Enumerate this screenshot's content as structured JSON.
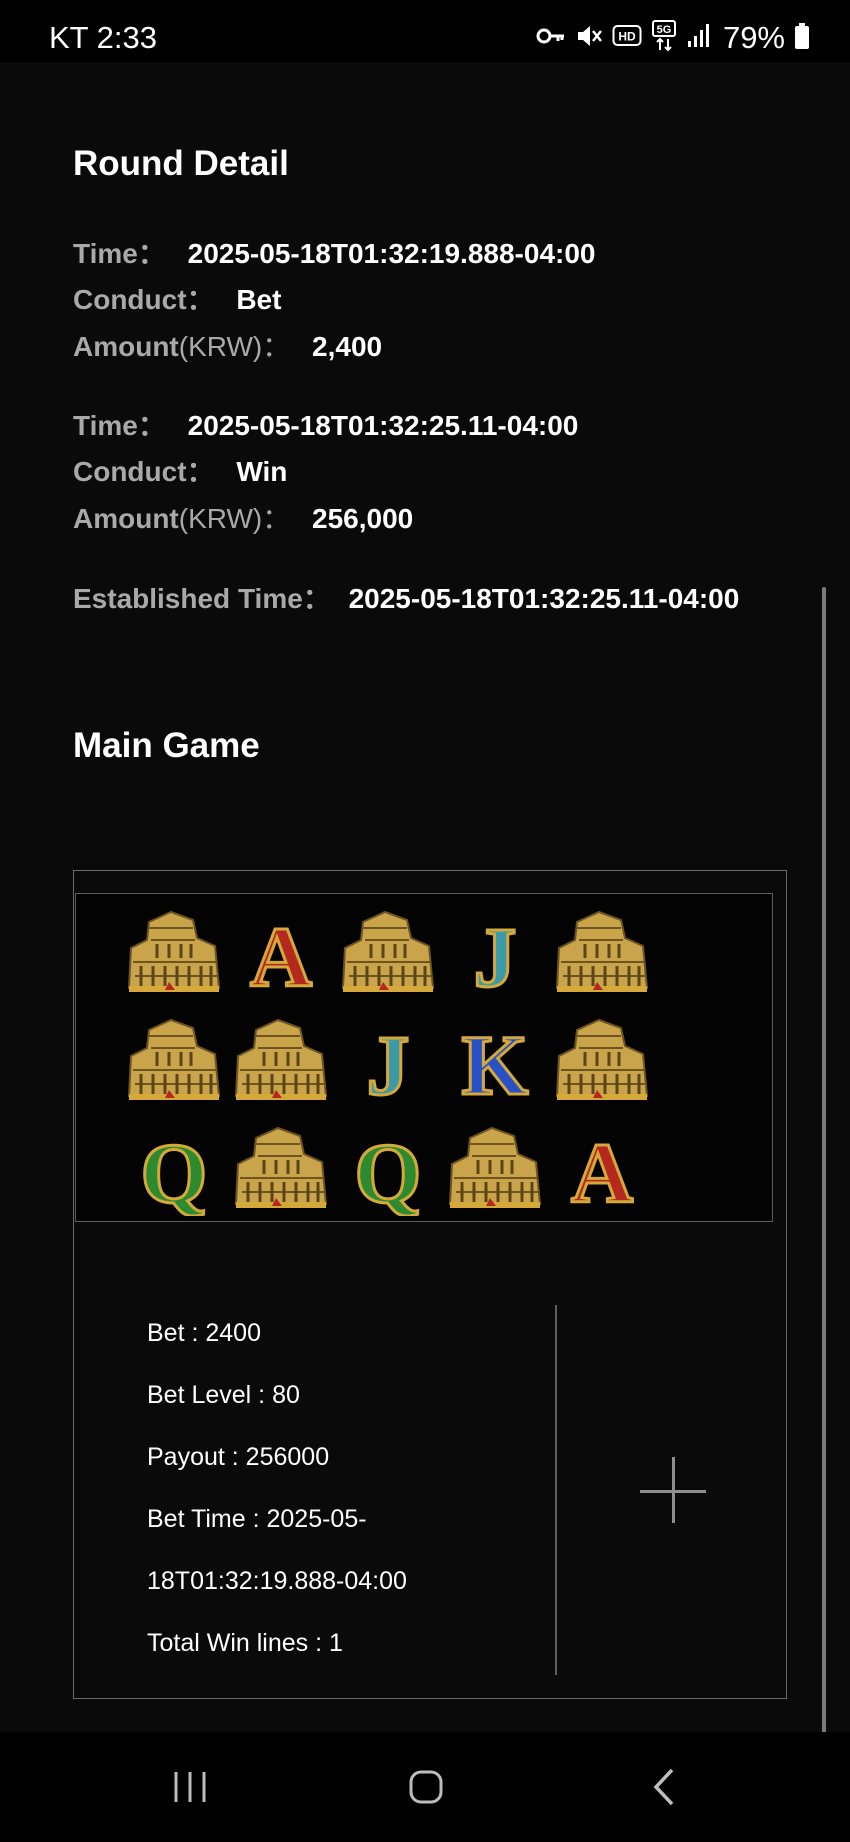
{
  "status_bar": {
    "time": "KT 2:33",
    "battery": "79%",
    "icons": [
      "key-icon",
      "mute-icon",
      "hd-icon",
      "5g-icon",
      "signal-icon",
      "battery-icon"
    ]
  },
  "round_detail": {
    "title": "Round Detail",
    "labels": {
      "time": "Time：",
      "conduct": "Conduct：",
      "amount": "Amount",
      "amount_unit": "(KRW)：",
      "established": "Established Time："
    },
    "entries": [
      {
        "time": "2025-05-18T01:32:19.888-04:00",
        "conduct": "Bet",
        "amount": "2,400"
      },
      {
        "time": "2025-05-18T01:32:25.11-04:00",
        "conduct": "Win",
        "amount": "256,000"
      }
    ],
    "established_time": "2025-05-18T01:32:25.11-04:00"
  },
  "main_game": {
    "title": "Main Game",
    "reels": [
      [
        "colosseum",
        "A",
        "colosseum",
        "J",
        "colosseum"
      ],
      [
        "colosseum",
        "colosseum",
        "J",
        "K",
        "colosseum"
      ],
      [
        "Q",
        "colosseum",
        "Q",
        "colosseum",
        "A"
      ]
    ],
    "symbol_colors": {
      "A": "#b5281e",
      "K": "#2a50c8",
      "Q": "#2e8a2e",
      "J": "#3c9aa8",
      "trim": "#d4a93a"
    },
    "info": {
      "bet": "Bet : 2400",
      "bet_level": "Bet Level : 80",
      "payout": "Payout : 256000",
      "bet_time_line1": "Bet Time : 2025-05-",
      "bet_time_line2": "18T01:32:19.888-04:00",
      "total_win_lines": "Total Win lines : 1"
    }
  },
  "nav_bar": {
    "buttons": [
      "recent-apps",
      "home",
      "back"
    ]
  }
}
